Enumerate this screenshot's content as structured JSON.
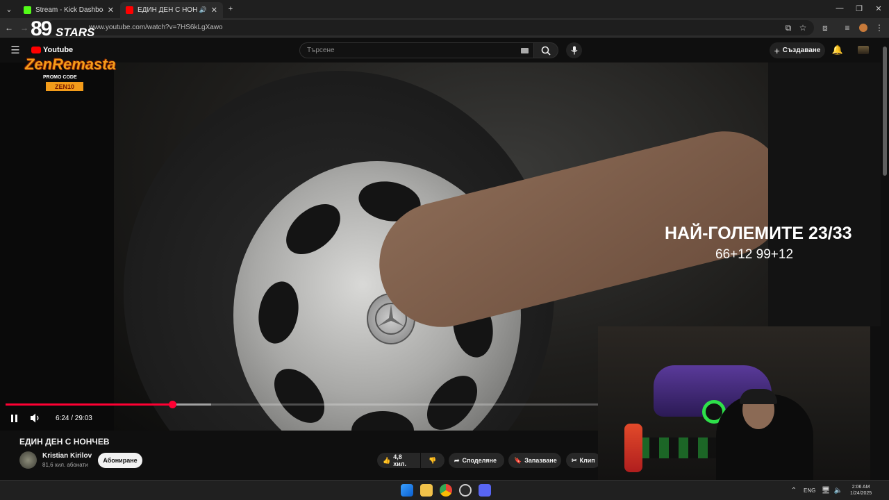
{
  "browser": {
    "tabs": [
      {
        "title": "Stream - Kick Dashboard",
        "favicon": "kick-icon",
        "active": false
      },
      {
        "title": "ЕДИН ДЕН С НОНЧЕВ - Yo",
        "favicon": "youtube-icon",
        "active": true
      }
    ],
    "url": "www.youtube.com/watch?v=7HS6kLgXawo"
  },
  "youtube": {
    "search_placeholder": "Търсене",
    "create_label": "Създаване"
  },
  "stream_overlay": {
    "logo_number": "89",
    "logo_text": "STARS",
    "youtube_badge": "Youtube",
    "promo_title": "ZenRemasta",
    "promo_code_label": "PROMO CODE",
    "promo_code": "ZEN10"
  },
  "video": {
    "overlay_title": "НАЙ-ГОЛЕМИТЕ 23/33",
    "overlay_subtitle": "66+12 99+12",
    "current_time": "6:24",
    "duration": "29:03",
    "time_display": "6:24 / 29:03",
    "progress_fraction": 0.2203,
    "buffered_fraction": 0.272
  },
  "info": {
    "title": "ЕДИН ДЕН С НОНЧЕВ",
    "channel_name": "Kristian Kirilov",
    "subscribers": "81,6 хил. абонати",
    "subscribe_label": "Абониране",
    "likes": "4,8 хил.",
    "share_label": "Споделяне",
    "save_label": "Запазване",
    "clip_label": "Клип"
  },
  "taskbar": {
    "language": "ENG",
    "time": "2:06 AM",
    "date": "1/24/2025"
  },
  "colors": {
    "accent_red": "#ff0033",
    "promo_orange": "#f39c1a",
    "background": "#0f0f0f"
  }
}
